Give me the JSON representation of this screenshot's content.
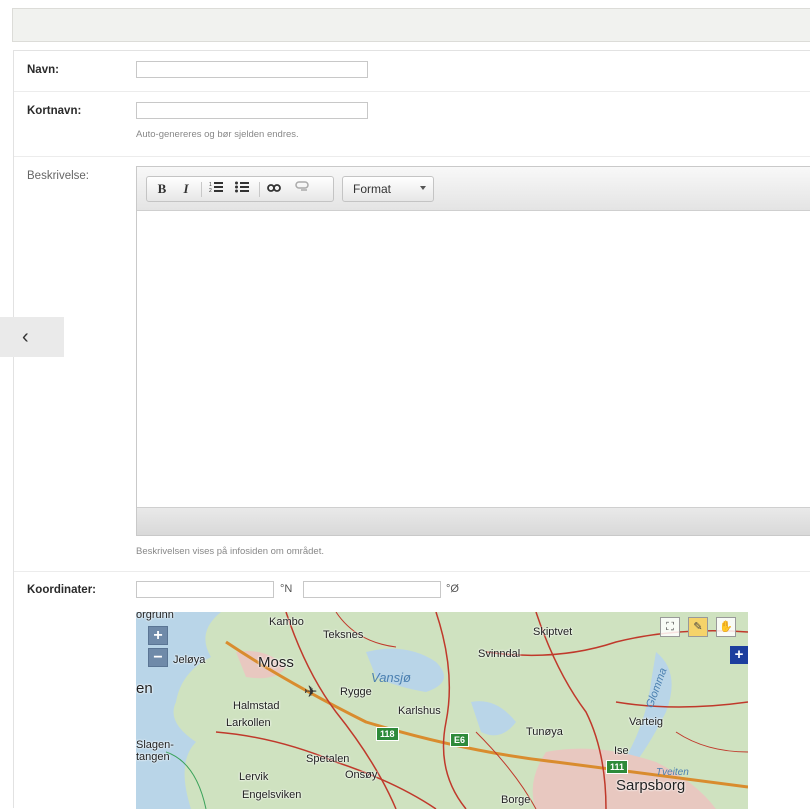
{
  "form": {
    "name_label": "Navn:",
    "name_value": "",
    "shortname_label": "Kortnavn:",
    "shortname_value": "",
    "shortname_help": "Auto-genereres og bør sjelden endres.",
    "description_label": "Beskrivelse:",
    "description_help": "Beskrivelsen vises på infosiden om området.",
    "coordinates_label": "Koordinater:",
    "lat_value": "",
    "lat_unit": "°N",
    "lon_value": "",
    "lon_unit": "°Ø"
  },
  "editor": {
    "bold_icon": "B",
    "italic_icon": "I",
    "ordered_list_icon": "⅓",
    "unordered_list_icon": "•",
    "link_icon": "∞",
    "unlink_icon": "≈",
    "format_label": "Format"
  },
  "nav": {
    "back_glyph": "‹"
  },
  "map": {
    "zoom_in": "+",
    "zoom_out": "−",
    "labels": [
      "orgrunn",
      "Kambo",
      "Teksnes",
      "Skiptvet",
      "Jeløya",
      "Moss",
      "Svinndal",
      "Vansjø",
      "en",
      "Rygge",
      "Halmstad",
      "Larkollen",
      "Karlshus",
      "Glomma",
      "Varteig",
      "Slagen-",
      "tangen",
      "Tunøya",
      "Spetalen",
      "Ise",
      "Onsøy",
      "Lervik",
      "Engelsviken",
      "Borge",
      "Sarpsborg",
      "Tveiten"
    ],
    "road_badges": [
      "118",
      "E6",
      "111"
    ]
  }
}
